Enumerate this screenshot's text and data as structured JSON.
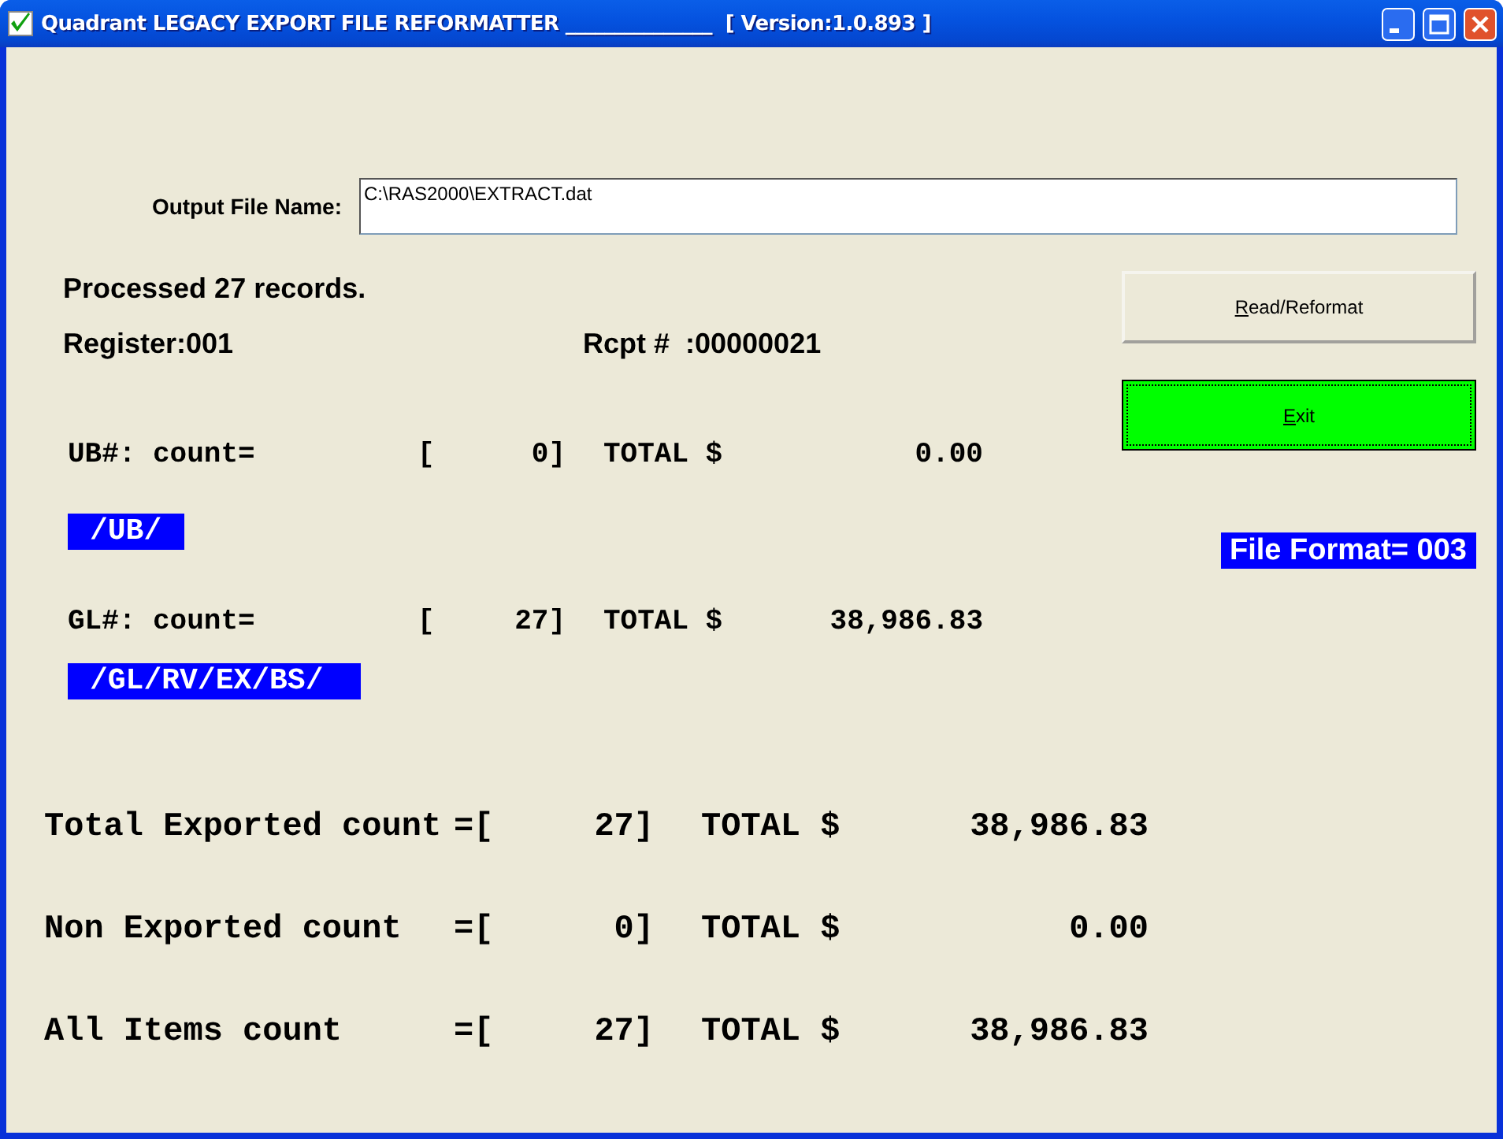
{
  "window": {
    "title": "Quadrant LEGACY EXPORT FILE REFORMATTER _______________  [ Version:1.0.893 ]"
  },
  "output_file": {
    "label": "Output File Name:",
    "value": "C:\\RAS2000\\EXTRACT.dat"
  },
  "status": "Processed 27 records.",
  "register": "Register:001",
  "receipt": "Rcpt #  :00000021",
  "groups": [
    {
      "label": "UB#: count=",
      "bracket": "[",
      "count": "0]",
      "total_label": "TOTAL $",
      "total": "0.00",
      "tag": "/UB/"
    },
    {
      "label": "GL#: count=",
      "bracket": "[",
      "count": "27]",
      "total_label": "TOTAL $",
      "total": "38,986.83",
      "tag": "/GL/RV/EX/BS/"
    }
  ],
  "buttons": [
    {
      "label": "Read/Reformat",
      "kind": "default"
    },
    {
      "label": "Exit",
      "kind": "focused"
    }
  ],
  "file_format": "File Format= 003",
  "summary": [
    {
      "label": "Total Exported count",
      "bracket": "=[",
      "count": "27]",
      "total_label": "TOTAL $",
      "total": "38,986.83"
    },
    {
      "label": "Non Exported count",
      "bracket": "=[",
      "count": "0]",
      "total_label": "TOTAL $",
      "total": "0.00"
    },
    {
      "label": "All Items count",
      "bracket": "=[",
      "count": "27]",
      "total_label": "TOTAL $",
      "total": "38,986.83"
    }
  ]
}
